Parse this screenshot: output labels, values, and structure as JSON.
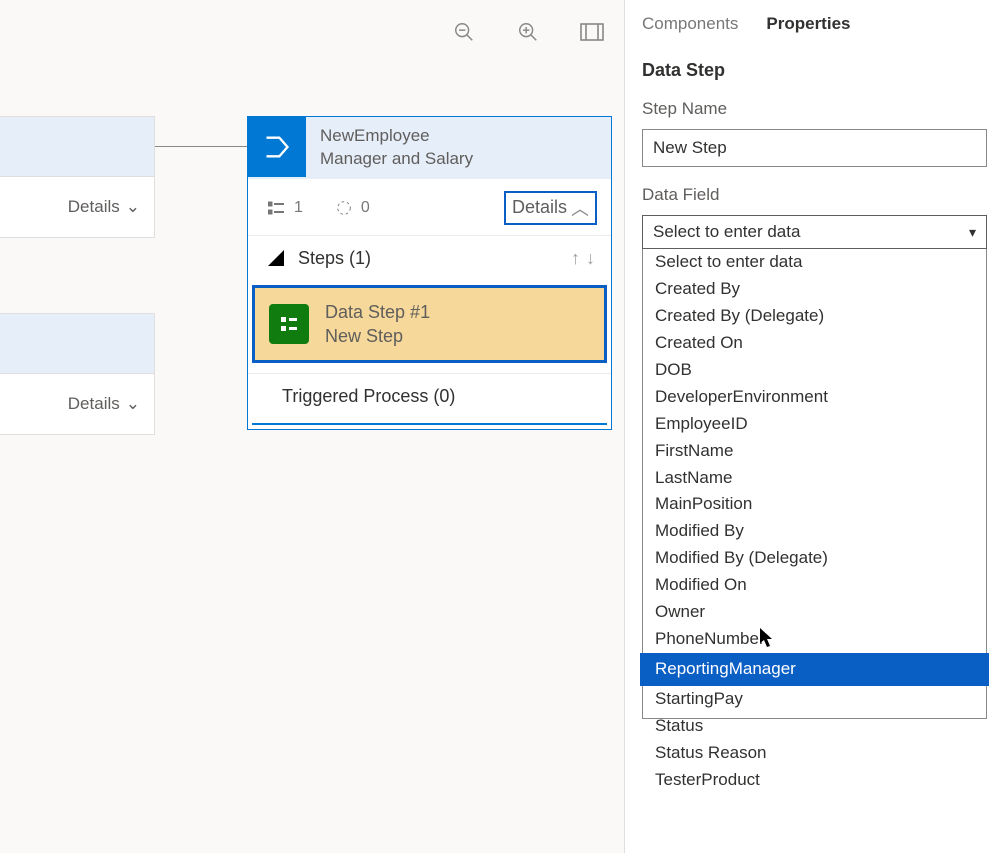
{
  "canvas": {
    "stub1_details": "Details",
    "stub2_details": "Details"
  },
  "flowCard": {
    "title_l1": "NewEmployee",
    "title_l2": "Manager and Salary",
    "metric_steps": "1",
    "metric_loop": "0",
    "details_btn": "Details",
    "steps_header": "Steps (1)",
    "step_title": "Data Step #1",
    "step_name": "New Step",
    "triggered_header": "Triggered Process (0)"
  },
  "panel": {
    "tab_components": "Components",
    "tab_properties": "Properties",
    "section_title": "Data Step",
    "step_name_label": "Step Name",
    "step_name_value": "New Step",
    "data_field_label": "Data Field",
    "select_placeholder": "Select to enter data",
    "options": [
      "Select to enter data",
      "Created By",
      "Created By (Delegate)",
      "Created On",
      "DOB",
      "DeveloperEnvironment",
      "EmployeeID",
      "FirstName",
      "LastName",
      "MainPosition",
      "Modified By",
      "Modified By (Delegate)",
      "Modified On",
      "Owner",
      "PhoneNumber",
      "ReportingManager",
      "StartingPay",
      "Status",
      "Status Reason",
      "TesterProduct"
    ],
    "hover_index": 15
  }
}
